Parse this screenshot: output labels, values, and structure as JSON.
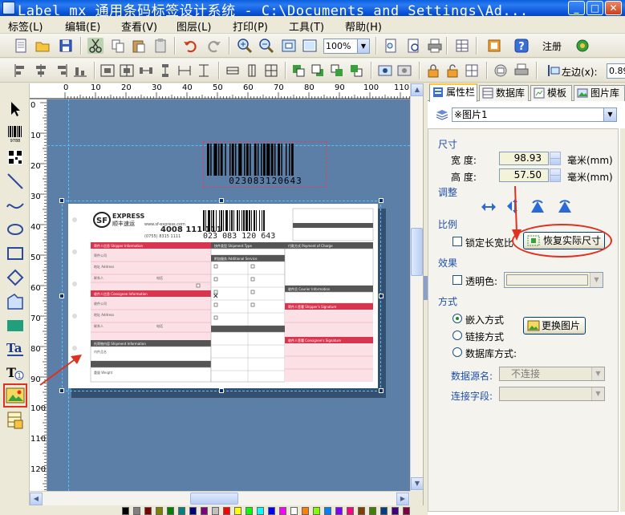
{
  "window": {
    "title": "Label mx 通用条码标签设计系统 - C:\\Documents and Settings\\Ad...",
    "minimize": "_",
    "maximize": "□",
    "close": "✕"
  },
  "menu": [
    {
      "label": "标签(L)"
    },
    {
      "label": "编辑(E)"
    },
    {
      "label": "查看(V)"
    },
    {
      "label": "图层(L)"
    },
    {
      "label": "打印(P)"
    },
    {
      "label": "工具(T)"
    },
    {
      "label": "帮助(H)"
    }
  ],
  "toolbar": {
    "zoom_value": "100%",
    "register_label": "注册",
    "left_margin_label": "左边(x):",
    "left_margin_value": "0.89"
  },
  "canvas": {
    "barcode_text": "023083120643"
  },
  "waybill": {
    "logo": "SF",
    "brand": "EXPRESS",
    "brand_cn": "顺丰速运",
    "hotline": "4008 111 111",
    "hotline2": "(0755) 8315 1111",
    "website": "www.sf-express.com",
    "number": "023 083 120 643",
    "sections": [
      "寄件人信息 Shipper Information",
      "收件人信息 Consignee Information",
      "托寄物内容 Shipment Information",
      "快件类型 Shipment Type",
      "附加服务 Additional Service",
      "付款方式 Payment of Charge",
      "收件员 Courier Information",
      "寄件人签署 Shipper's Signature",
      "收件人签署 Consignee's Signature"
    ]
  },
  "tabs": [
    {
      "label": "属性栏",
      "active": true
    },
    {
      "label": "数据库",
      "active": false
    },
    {
      "label": "模板",
      "active": false
    },
    {
      "label": "图片库",
      "active": false
    }
  ],
  "props": {
    "object_select": "※图片1",
    "size_section": "尺寸",
    "width_label": "宽    度:",
    "width_value": "98.93",
    "height_label": "高    度:",
    "height_value": "57.50",
    "unit": "毫米(mm)",
    "adjust_section": "调整",
    "ratio_section": "比例",
    "lock_ratio": "锁定长宽比",
    "restore_button": "恢复实际尺寸",
    "effect_section": "效果",
    "transparent": "透明色:",
    "mode_section": "方式",
    "embed": "嵌入方式",
    "link": "链接方式",
    "database_mode": "数据库方式:",
    "replace_button": "更换图片",
    "datasource_label": "数据源名:",
    "datasource_value": "不连接",
    "field_label": "连接字段:",
    "field_value": ""
  },
  "colors": {
    "accent": "#e03020",
    "canvas_bg": "#5b7fa6",
    "section_title": "#1f4fa8"
  }
}
